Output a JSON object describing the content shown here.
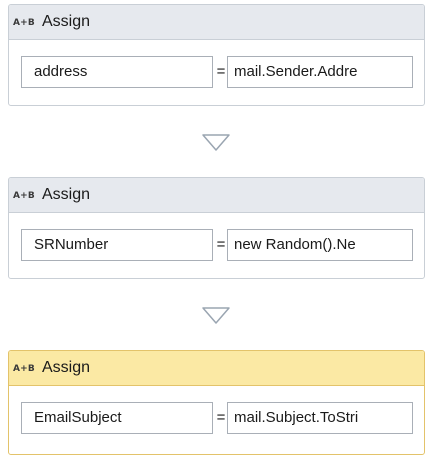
{
  "activities": [
    {
      "icon_text": "A+B",
      "title": "Assign",
      "to": "address",
      "operator": "=",
      "value": "mail.Sender.Addre",
      "selected": false
    },
    {
      "icon_text": "A+B",
      "title": "Assign",
      "to": "SRNumber",
      "operator": "=",
      "value": "new Random().Ne",
      "selected": false
    },
    {
      "icon_text": "A+B",
      "title": "Assign",
      "to": "EmailSubject",
      "operator": "=",
      "value": "mail.Subject.ToStri",
      "selected": true
    }
  ],
  "colors": {
    "header_default": "#e6e9ee",
    "header_selected": "#fbe9a4",
    "border_default": "#c9cfd6",
    "border_selected": "#e3c36a",
    "connector": "#9aa5b1"
  }
}
